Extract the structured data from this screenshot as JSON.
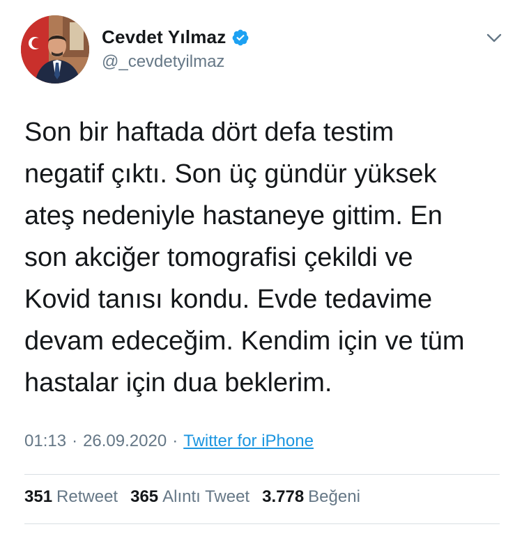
{
  "author": {
    "display_name": "Cevdet Yılmaz",
    "handle": "@_cevdetyilmaz",
    "verified": true
  },
  "icons": {
    "verified": "verified-badge-icon",
    "menu": "chevron-down-icon"
  },
  "tweet": {
    "text": "Son bir haftada dört defa testim\nnegatif çıktı. Son üç gündür yüksek\nateş nedeniyle hastaneye gittim. En\nson akciğer tomografisi çekildi ve\nKovid tanısı kondu. Evde tedavime\ndevam edeceğim. Kendim için ve tüm\nhastalar için dua beklerim.",
    "time": "01:13",
    "date": "26.09.2020",
    "separator": "·",
    "source": "Twitter for iPhone"
  },
  "stats": {
    "retweets": {
      "count": "351",
      "label": "Retweet"
    },
    "quotes": {
      "count": "365",
      "label": "Alıntı Tweet"
    },
    "likes": {
      "count": "3.778",
      "label": "Beğeni"
    }
  },
  "colors": {
    "text": "#14171a",
    "secondary": "#657786",
    "link": "#1b95e0",
    "verified": "#1da1f2",
    "divider": "#d8dee3"
  }
}
